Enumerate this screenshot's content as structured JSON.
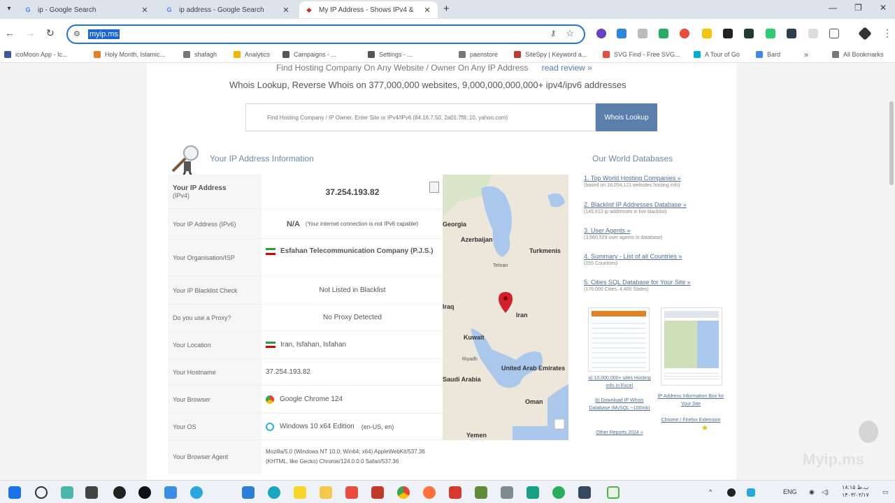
{
  "tabs": [
    {
      "title": "ip - Google Search",
      "favicon": "G"
    },
    {
      "title": "ip address - Google Search",
      "favicon": "G"
    },
    {
      "title": "My IP Address - Shows IPv4 &",
      "favicon": "◆"
    }
  ],
  "omnibox": {
    "url": "myip.ms"
  },
  "bookmarks": [
    {
      "label": "icoMoon App - Ic...",
      "color": "#3b5998"
    },
    {
      "label": "Holy Month, Islamic...",
      "color": "#e67e22"
    },
    {
      "label": "shafagh",
      "color": "#777777"
    },
    {
      "label": "Analytics",
      "color": "#f4b400"
    },
    {
      "label": "Campaigns - ...",
      "color": "#555555"
    },
    {
      "label": "Settings - ...",
      "color": "#555555"
    },
    {
      "label": "paenstore",
      "color": "#777777"
    },
    {
      "label": "SiteSpy | Keyword a...",
      "color": "#c0392b"
    },
    {
      "label": "SVG Find - Free SVG...",
      "color": "#e74c3c"
    },
    {
      "label": "A Tour of Go",
      "color": "#00add8"
    },
    {
      "label": "Bard",
      "color": "#4285f4"
    },
    {
      "label": "All Bookmarks",
      "color": "#777777"
    }
  ],
  "page": {
    "top_cut": "Find Hosting Company On Any Website / Owner On Any IP Address",
    "top_cut_link": "read review »",
    "whois_line": "Whois Lookup, Reverse Whois on 377,000,000 websites, 9,000,000,000,000+ ipv4/ipv6 addresses",
    "search_placeholder": "Find Hosting Company / IP Owner. Enter Site or IPv4/IPv6 (84.16.7.50, 2a01:7f8::10, yahoo.com)",
    "search_button": "Whois Lookup",
    "info_title": "Your IP Address Information",
    "rows": [
      {
        "label": "Your IP Address",
        "sub": "(IPv4)",
        "value": "37.254.193.82"
      },
      {
        "label": "Your IP Address (IPv6)",
        "value": "N/A",
        "note": "(Your internet connection is not IPv6 capable)"
      },
      {
        "label": "Your Organisation/ISP",
        "value": "Esfahan Telecommunication Company (P.J.S.)"
      },
      {
        "label": "Your IP Blacklist Check",
        "value": "Not Listed in Blacklist"
      },
      {
        "label": "Do you use a Proxy?",
        "value": "No Proxy Detected"
      },
      {
        "label": "Your Location",
        "value": "Iran,  Isfahan,  Isfahan"
      },
      {
        "label": "Your Hostname",
        "value": "37.254.193.82"
      },
      {
        "label": "Your Browser",
        "value": "Google Chrome 124"
      },
      {
        "label": "Your OS",
        "value": "Windows 10 x64 Edition",
        "note": "(en-US, en)"
      },
      {
        "label": "Your Browser Agent",
        "value": "Mozilla/5.0 (Windows NT 10.0; Win64; x64) AppleWebKit/537.36 (KHTML, like Gecko) Chrome/124.0.0.0 Safari/537.36"
      }
    ],
    "map_labels": [
      "Georgia",
      "Azerbaijan",
      "Turkmenis",
      "Tehran",
      "Iraq",
      "Iran",
      "Kuwait",
      "Riyadh",
      "Saudi Arabia",
      "United Arab Emirates",
      "Oman",
      "Yemen"
    ],
    "sidebar": {
      "title": "Our World Databases",
      "items": [
        {
          "title": "1. Top World Hosting Companies »",
          "sub": "(based on 18,054,121 websites hosting info)"
        },
        {
          "title": "2. Blacklist IP Addresses Database »",
          "sub": "(145,613 ip addresses in live blacklist)"
        },
        {
          "title": "3. User Agents »",
          "sub": "(3,660,529 user agents in database)"
        },
        {
          "title": "4. Summary - List of all Countries »",
          "sub": "(255 Countries)"
        },
        {
          "title": "5. Cities SQL Database for Your Site »",
          "sub": "(176,000 Cities, 4,400 States)"
        }
      ],
      "thumb1_caption": "a) 10,000,000+ sites Hosting Info in Excel",
      "thumb1_caption2": "b) Download IP Whois Database (MySQL ~100mb)",
      "thumb1_caption3": "Other Reports 2024 »",
      "thumb2_caption": "IP Address Information Box for Your Site",
      "thumb2_caption2": "Chrome / Firefox Extension"
    },
    "watermark": "Myip.ms"
  },
  "taskbar": {
    "lang": "ENG",
    "time": "۱۸:۱۵ ب.ظ",
    "date": "۱۴۰۳/۰۲/۱۷"
  }
}
